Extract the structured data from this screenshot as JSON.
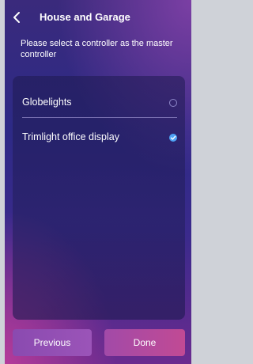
{
  "header": {
    "back_icon": "chevron-left-icon",
    "title": "House and Garage"
  },
  "subtitle": "Please select a controller as the master controller",
  "controllers": [
    {
      "label": "Globelights",
      "selected": false
    },
    {
      "label": "Trimlight office display",
      "selected": true
    }
  ],
  "footer": {
    "previous_label": "Previous",
    "done_label": "Done"
  },
  "colors": {
    "accent_check": "#4fa3f5",
    "button_previous": "#8a4ab0",
    "button_done": "#c14a94"
  }
}
